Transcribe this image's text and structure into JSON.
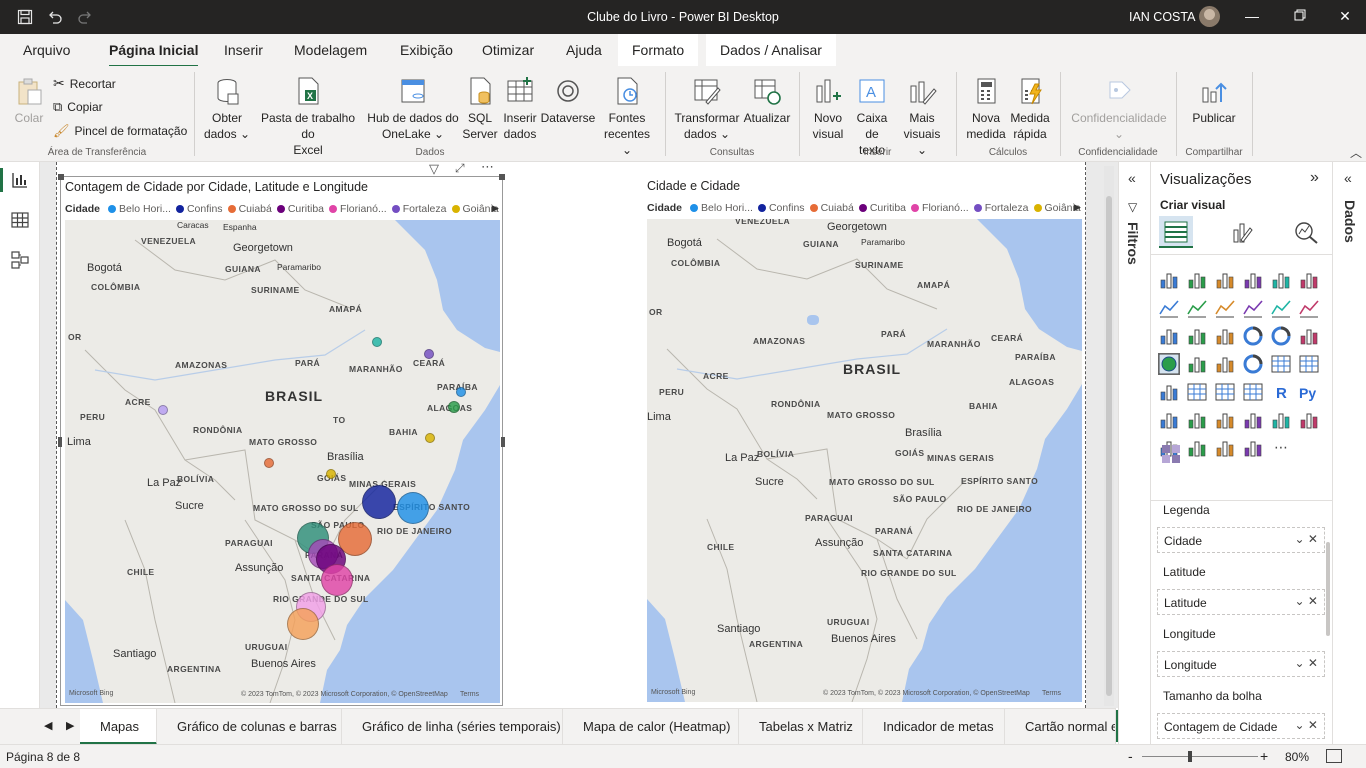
{
  "window": {
    "title": "Clube do Livro - Power BI Desktop",
    "user": "IAN COSTA"
  },
  "menu": {
    "tabs": [
      "Arquivo",
      "Página Inicial",
      "Inserir",
      "Modelagem",
      "Exibição",
      "Otimizar",
      "Ajuda",
      "Formato",
      "Dados / Analisar"
    ]
  },
  "ribbon": {
    "clipboard": {
      "colar": "Colar",
      "recortar": "Recortar",
      "copiar": "Copiar",
      "pincel": "Pincel de formatação",
      "group": "Área de Transferência"
    },
    "dados": {
      "obter1": "Obter",
      "obter2": "dados",
      "excel1": "Pasta de trabalho do",
      "excel2": "Excel",
      "onelake1": "Hub de dados do",
      "onelake2": "OneLake",
      "sql1": "SQL",
      "sql2": "Server",
      "inserir1": "Inserir",
      "inserir2": "dados",
      "dataverse": "Dataverse",
      "fontes1": "Fontes",
      "fontes2": "recentes",
      "group": "Dados"
    },
    "consultas": {
      "transformar1": "Transformar",
      "transformar2": "dados",
      "atualizar": "Atualizar",
      "group": "Consultas"
    },
    "inserir": {
      "novo1": "Novo",
      "novo2": "visual",
      "caixa1": "Caixa de",
      "caixa2": "texto",
      "mais1": "Mais",
      "mais2": "visuais",
      "group": "Inserir"
    },
    "calculos": {
      "nova1": "Nova",
      "nova2": "medida",
      "rapida1": "Medida",
      "rapida2": "rápida",
      "group": "Cálculos"
    },
    "confidencial": {
      "label": "Confidencialidade",
      "group": "Confidencialidade"
    },
    "compartilhar": {
      "publicar": "Publicar",
      "group": "Compartilhar"
    }
  },
  "visual1": {
    "title": "Contagem de Cidade por Cidade, Latitude e Longitude",
    "legend_title": "Cidade",
    "legend": [
      {
        "name": "Belo Hori...",
        "color": "#1e90e8"
      },
      {
        "name": "Confins",
        "color": "#12239e"
      },
      {
        "name": "Cuiabá",
        "color": "#e66c37"
      },
      {
        "name": "Curitiba",
        "color": "#6b007b"
      },
      {
        "name": "Florianó...",
        "color": "#e044a7"
      },
      {
        "name": "Fortaleza",
        "color": "#744ec2"
      },
      {
        "name": "Goiânia",
        "color": "#d9b300"
      }
    ]
  },
  "visual2": {
    "title": "Cidade e Cidade",
    "legend_title": "Cidade",
    "legend": [
      {
        "name": "Belo Hori...",
        "color": "#1e90e8"
      },
      {
        "name": "Confins",
        "color": "#12239e"
      },
      {
        "name": "Cuiabá",
        "color": "#e66c37"
      },
      {
        "name": "Curitiba",
        "color": "#6b007b"
      },
      {
        "name": "Florianó...",
        "color": "#e044a7"
      },
      {
        "name": "Fortaleza",
        "color": "#744ec2"
      },
      {
        "name": "Goiânia",
        "color": "#d9b300"
      }
    ]
  },
  "maplabels": {
    "venezuela": "VENEZUELA",
    "caracas": "Caracas",
    "espanha": "Espanha",
    "georgetown": "Georgetown",
    "paramaribo": "Paramaribo",
    "guiana": "GUIANA",
    "suriname": "SURINAME",
    "bogota": "Bogotá",
    "colombia": "COLÔMBIA",
    "amapa": "AMAPÁ",
    "or": "OR",
    "amazonas": "AMAZONAS",
    "para": "PARÁ",
    "maranhao": "MARANHÃO",
    "ceara": "CEARÁ",
    "paraiba": "PARAÍBA",
    "brasil": "BRASIL",
    "peru": "PERU",
    "acre": "ACRE",
    "alagoas": "ALAGOAS",
    "lima": "Lima",
    "rondonia": "RONDÔNIA",
    "to": "TO",
    "bahia": "BAHIA",
    "matogrosso": "MATO GROSSO",
    "brasilia": "Brasília",
    "goias": "GOIÁS",
    "lapaz": "La Paz",
    "bolivia": "BOLÍVIA",
    "minasgerais": "MINAS GERAIS",
    "sucre": "Sucre",
    "matogrossosul": "MATO GROSSO DO SUL",
    "espiritosanto": "ESPÍRITO SANTO",
    "saopaulo": "SÃO PAULO",
    "riodejaneiro": "RIO DE JANEIRO",
    "paraguai": "PARAGUAI",
    "assuncao": "Assunção",
    "parana": "PARANÁ",
    "chile": "CHILE",
    "santacatarina": "SANTA CATARINA",
    "riograndedosul": "RIO GRANDE DO SUL",
    "santiago": "Santiago",
    "uruguai": "URUGUAI",
    "argentina": "ARGENTINA",
    "buenosaires": "Buenos Aires",
    "bing": "Microsoft Bing",
    "attribution": "© 2023 TomTom, © 2023 Microsoft Corporation, © OpenStreetMap",
    "terms": "Terms"
  },
  "pages": [
    "Mapas",
    "Gráfico de colunas e barras",
    "Gráfico de linha (séries temporais)",
    "Mapa de calor (Heatmap)",
    "Tabelas x Matriz",
    "Indicador de metas",
    "Cartão normal e"
  ],
  "status": {
    "page": "Página 8 de 8",
    "zoom_minus": "-",
    "zoom_plus": "+",
    "zoom": "80%"
  },
  "filters": {
    "label": "Filtros"
  },
  "visualizations": {
    "title": "Visualizações",
    "subtitle": "Criar visual",
    "wells": [
      {
        "label": "Legenda",
        "value": "Cidade"
      },
      {
        "label": "Latitude",
        "value": "Latitude"
      },
      {
        "label": "Longitude",
        "value": "Longitude"
      },
      {
        "label": "Tamanho da bolha",
        "value": "Contagem de Cidade"
      }
    ]
  },
  "data": {
    "label": "Dados"
  }
}
